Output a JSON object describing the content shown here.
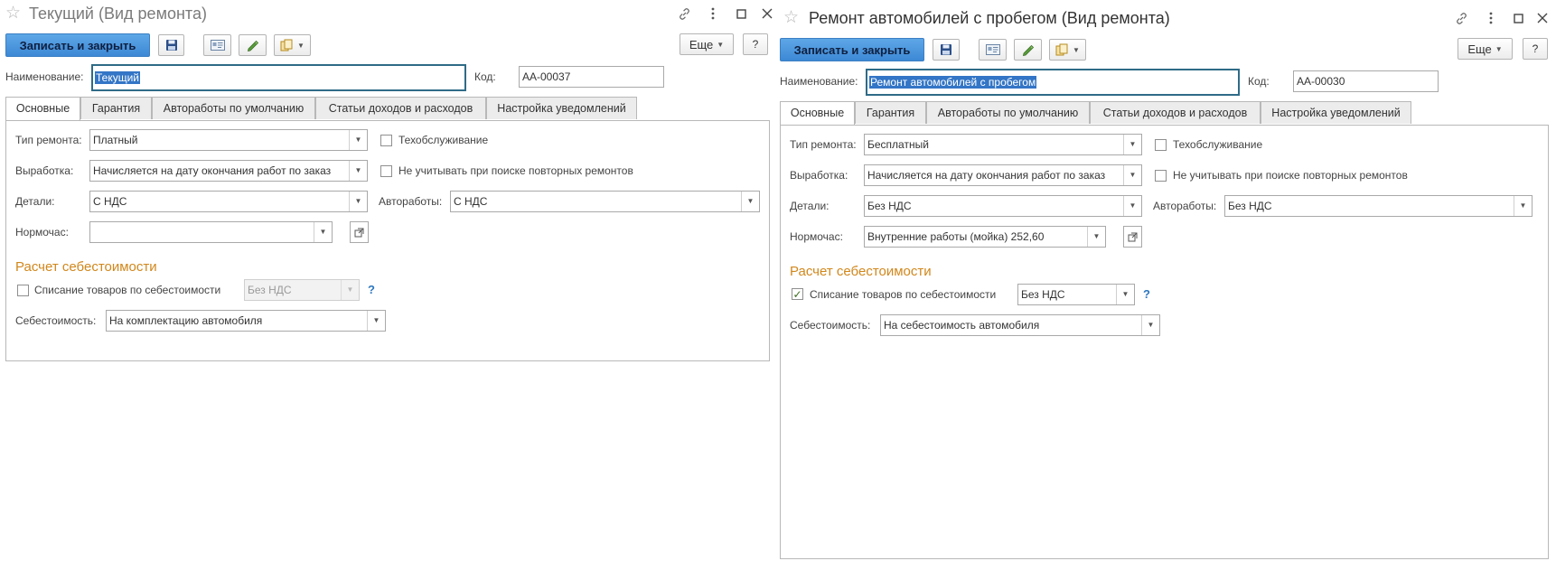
{
  "toolbar_common": {
    "save_close_label": "Записать и закрыть",
    "more_label": "Еще",
    "help_label": "?"
  },
  "labels": {
    "name": "Наименование:",
    "code": "Код:",
    "repair_type": "Тип ремонта:",
    "output": "Выработка:",
    "parts": "Детали:",
    "autoworks": "Автоработы:",
    "norm_hour": "Нормочас:",
    "maintenance": "Техобслуживание",
    "ignore_repeat": "Не учитывать при поиске повторных ремонтов",
    "cost_section": "Расчет себестоимости",
    "write_off": "Списание товаров по себестоимости",
    "cost": "Себестоимость:",
    "help_mark": "?"
  },
  "tabs": [
    "Основные",
    "Гарантия",
    "Автоработы по умолчанию",
    "Статьи доходов и расходов",
    "Настройка уведомлений"
  ],
  "icons": {
    "star": "star-icon",
    "link": "link-icon",
    "menu": "kebab-menu-icon",
    "maximize": "maximize-icon",
    "close": "close-icon",
    "save": "floppy-disk-icon",
    "card": "card-icon",
    "edit": "pencil-edit-icon",
    "documents": "documents-icon",
    "open": "open-in-new-icon"
  },
  "colors": {
    "accent": "#3d88d5",
    "section": "#d1871c",
    "selection": "#3375c6",
    "focus_border": "#2f6b87"
  },
  "forms": [
    {
      "title": "Текущий (Вид ремонта)",
      "name": "Текущий",
      "code": "АА-00037",
      "repair_type": "Платный",
      "output": "Начисляется на дату окончания работ по заказ",
      "parts": "С НДС",
      "autoworks": "С НДС",
      "norm_hour": "",
      "maintenance_checked": false,
      "ignore_repeat_checked": false,
      "write_off_checked": false,
      "write_off_vat": "Без НДС",
      "cost": "На комплектацию автомобиля",
      "active_tab": "Основные"
    },
    {
      "title": "Ремонт автомобилей с пробегом (Вид ремонта)",
      "name": "Ремонт автомобилей с пробегом",
      "code": "АА-00030",
      "repair_type": "Бесплатный",
      "output": "Начисляется на дату окончания работ по заказ",
      "parts": "Без НДС",
      "autoworks": "Без НДС",
      "norm_hour": "Внутренние работы (мойка) 252,60",
      "maintenance_checked": false,
      "ignore_repeat_checked": false,
      "write_off_checked": true,
      "write_off_vat": "Без НДС",
      "cost": "На себестоимость автомобиля",
      "active_tab": "Основные"
    }
  ]
}
